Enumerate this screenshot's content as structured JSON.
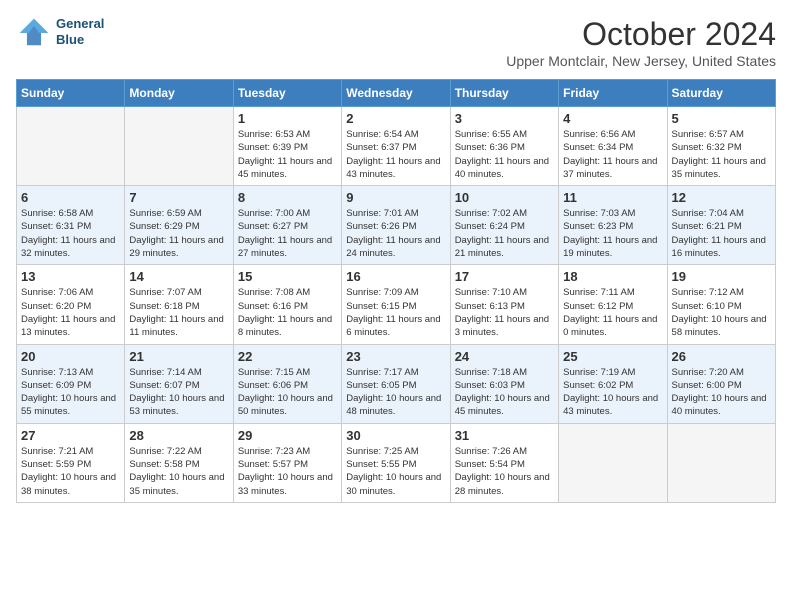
{
  "header": {
    "logo_line1": "General",
    "logo_line2": "Blue",
    "month_title": "October 2024",
    "location": "Upper Montclair, New Jersey, United States"
  },
  "days_of_week": [
    "Sunday",
    "Monday",
    "Tuesday",
    "Wednesday",
    "Thursday",
    "Friday",
    "Saturday"
  ],
  "weeks": [
    [
      {
        "day": "",
        "empty": true
      },
      {
        "day": "",
        "empty": true
      },
      {
        "day": "1",
        "sunrise": "6:53 AM",
        "sunset": "6:39 PM",
        "daylight": "11 hours and 45 minutes."
      },
      {
        "day": "2",
        "sunrise": "6:54 AM",
        "sunset": "6:37 PM",
        "daylight": "11 hours and 43 minutes."
      },
      {
        "day": "3",
        "sunrise": "6:55 AM",
        "sunset": "6:36 PM",
        "daylight": "11 hours and 40 minutes."
      },
      {
        "day": "4",
        "sunrise": "6:56 AM",
        "sunset": "6:34 PM",
        "daylight": "11 hours and 37 minutes."
      },
      {
        "day": "5",
        "sunrise": "6:57 AM",
        "sunset": "6:32 PM",
        "daylight": "11 hours and 35 minutes."
      }
    ],
    [
      {
        "day": "6",
        "sunrise": "6:58 AM",
        "sunset": "6:31 PM",
        "daylight": "11 hours and 32 minutes."
      },
      {
        "day": "7",
        "sunrise": "6:59 AM",
        "sunset": "6:29 PM",
        "daylight": "11 hours and 29 minutes."
      },
      {
        "day": "8",
        "sunrise": "7:00 AM",
        "sunset": "6:27 PM",
        "daylight": "11 hours and 27 minutes."
      },
      {
        "day": "9",
        "sunrise": "7:01 AM",
        "sunset": "6:26 PM",
        "daylight": "11 hours and 24 minutes."
      },
      {
        "day": "10",
        "sunrise": "7:02 AM",
        "sunset": "6:24 PM",
        "daylight": "11 hours and 21 minutes."
      },
      {
        "day": "11",
        "sunrise": "7:03 AM",
        "sunset": "6:23 PM",
        "daylight": "11 hours and 19 minutes."
      },
      {
        "day": "12",
        "sunrise": "7:04 AM",
        "sunset": "6:21 PM",
        "daylight": "11 hours and 16 minutes."
      }
    ],
    [
      {
        "day": "13",
        "sunrise": "7:06 AM",
        "sunset": "6:20 PM",
        "daylight": "11 hours and 13 minutes."
      },
      {
        "day": "14",
        "sunrise": "7:07 AM",
        "sunset": "6:18 PM",
        "daylight": "11 hours and 11 minutes."
      },
      {
        "day": "15",
        "sunrise": "7:08 AM",
        "sunset": "6:16 PM",
        "daylight": "11 hours and 8 minutes."
      },
      {
        "day": "16",
        "sunrise": "7:09 AM",
        "sunset": "6:15 PM",
        "daylight": "11 hours and 6 minutes."
      },
      {
        "day": "17",
        "sunrise": "7:10 AM",
        "sunset": "6:13 PM",
        "daylight": "11 hours and 3 minutes."
      },
      {
        "day": "18",
        "sunrise": "7:11 AM",
        "sunset": "6:12 PM",
        "daylight": "11 hours and 0 minutes."
      },
      {
        "day": "19",
        "sunrise": "7:12 AM",
        "sunset": "6:10 PM",
        "daylight": "10 hours and 58 minutes."
      }
    ],
    [
      {
        "day": "20",
        "sunrise": "7:13 AM",
        "sunset": "6:09 PM",
        "daylight": "10 hours and 55 minutes."
      },
      {
        "day": "21",
        "sunrise": "7:14 AM",
        "sunset": "6:07 PM",
        "daylight": "10 hours and 53 minutes."
      },
      {
        "day": "22",
        "sunrise": "7:15 AM",
        "sunset": "6:06 PM",
        "daylight": "10 hours and 50 minutes."
      },
      {
        "day": "23",
        "sunrise": "7:17 AM",
        "sunset": "6:05 PM",
        "daylight": "10 hours and 48 minutes."
      },
      {
        "day": "24",
        "sunrise": "7:18 AM",
        "sunset": "6:03 PM",
        "daylight": "10 hours and 45 minutes."
      },
      {
        "day": "25",
        "sunrise": "7:19 AM",
        "sunset": "6:02 PM",
        "daylight": "10 hours and 43 minutes."
      },
      {
        "day": "26",
        "sunrise": "7:20 AM",
        "sunset": "6:00 PM",
        "daylight": "10 hours and 40 minutes."
      }
    ],
    [
      {
        "day": "27",
        "sunrise": "7:21 AM",
        "sunset": "5:59 PM",
        "daylight": "10 hours and 38 minutes."
      },
      {
        "day": "28",
        "sunrise": "7:22 AM",
        "sunset": "5:58 PM",
        "daylight": "10 hours and 35 minutes."
      },
      {
        "day": "29",
        "sunrise": "7:23 AM",
        "sunset": "5:57 PM",
        "daylight": "10 hours and 33 minutes."
      },
      {
        "day": "30",
        "sunrise": "7:25 AM",
        "sunset": "5:55 PM",
        "daylight": "10 hours and 30 minutes."
      },
      {
        "day": "31",
        "sunrise": "7:26 AM",
        "sunset": "5:54 PM",
        "daylight": "10 hours and 28 minutes."
      },
      {
        "day": "",
        "empty": true
      },
      {
        "day": "",
        "empty": true
      }
    ]
  ],
  "labels": {
    "sunrise": "Sunrise:",
    "sunset": "Sunset:",
    "daylight": "Daylight:"
  }
}
